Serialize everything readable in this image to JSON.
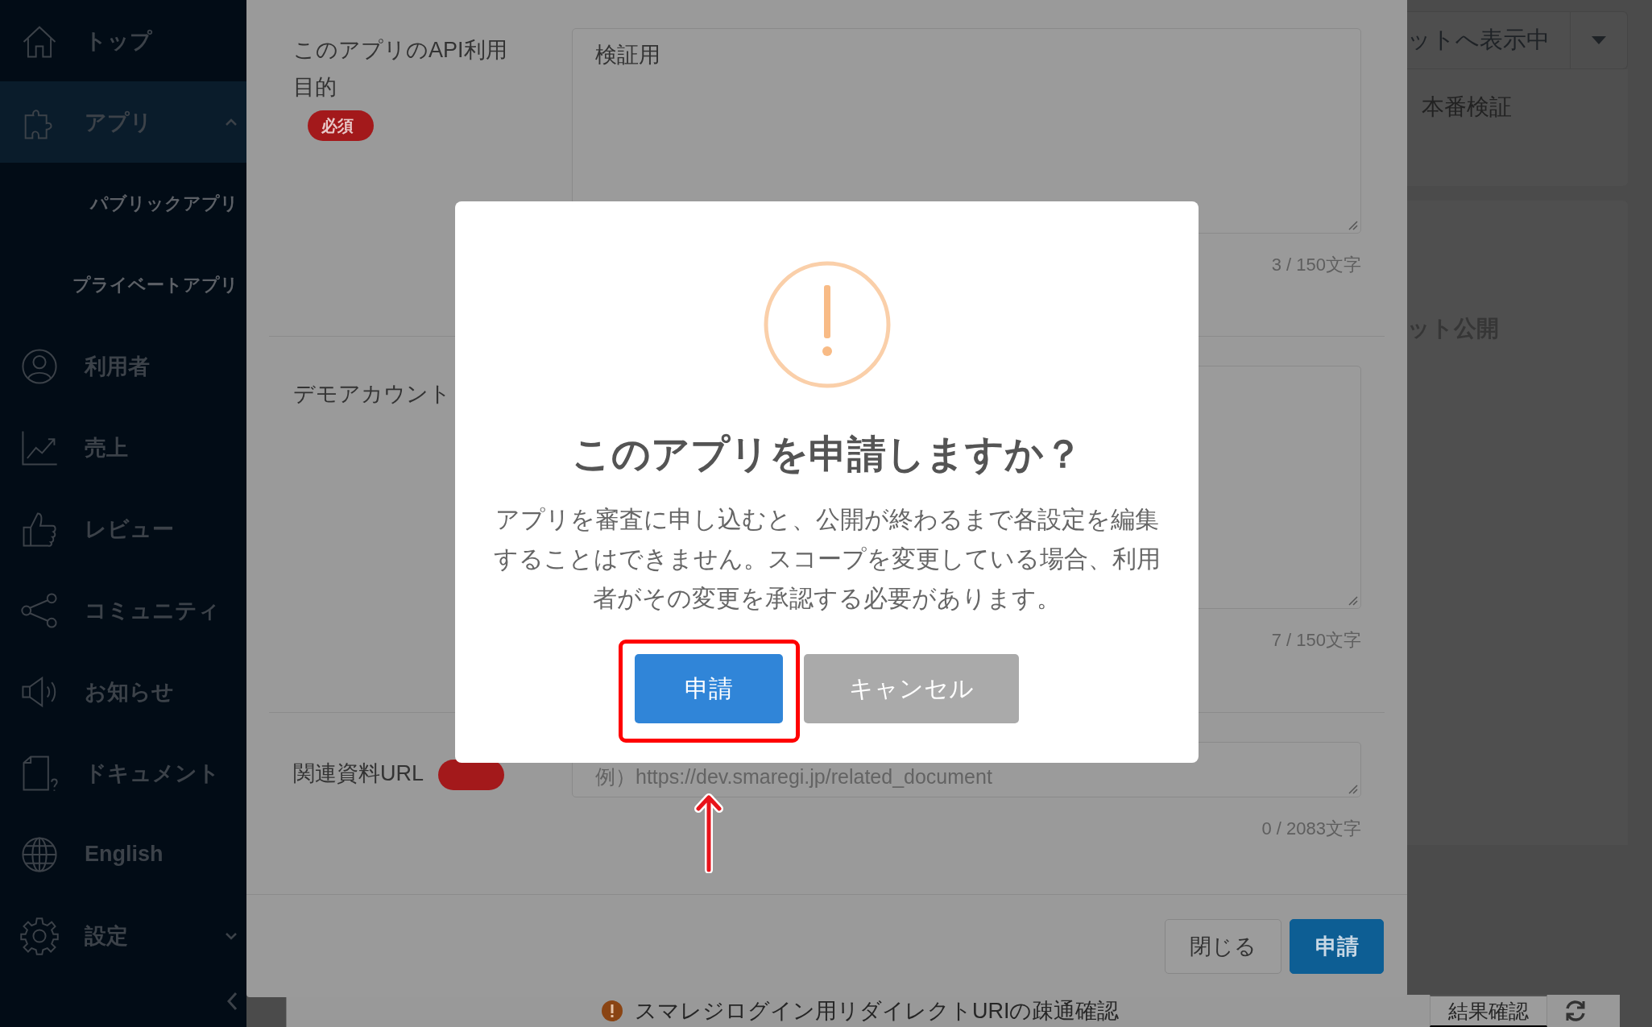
{
  "sidebar": {
    "items": [
      {
        "label": "トップ",
        "selected": false
      },
      {
        "label": "アプリ",
        "selected": true,
        "expanded": true,
        "children": [
          {
            "label": "パブリックアプリ",
            "selected": false
          },
          {
            "label": "プライベートアプリ",
            "selected": false
          }
        ]
      },
      {
        "label": "利用者",
        "selected": false
      },
      {
        "label": "売上",
        "selected": false
      },
      {
        "label": "レビュー",
        "selected": false
      },
      {
        "label": "コミュニティ",
        "selected": false
      },
      {
        "label": "お知らせ",
        "selected": false
      },
      {
        "label": "ドキュメント",
        "selected": false
      },
      {
        "label": "English",
        "selected": false
      },
      {
        "label": "設定",
        "selected": false,
        "expanded": false
      }
    ]
  },
  "background_page": {
    "dropdown": {
      "value": "ットへ表示中"
    },
    "environment_tab": "本番検証",
    "section_title": "ット公開",
    "check_row": {
      "label": "スマレジログイン用リダイレクトURIの疎通確認",
      "button": "結果確認"
    }
  },
  "modal": {
    "fields": [
      {
        "label": "このアプリのAPI利用目的",
        "required": true,
        "badge": "必須",
        "value": "検証用",
        "counter": "3 / 150文字"
      },
      {
        "label": "デモアカウント",
        "required": false,
        "counter": "7 / 150文字"
      },
      {
        "label": "関連資料URL",
        "required": true,
        "placeholder": "例）https://dev.smaregi.jp/related_document",
        "counter": "0 / 2083文字"
      }
    ],
    "buttons": [
      {
        "label": "閉じる",
        "kind": "secondary"
      },
      {
        "label": "申請",
        "kind": "primary"
      }
    ]
  },
  "confirm_dialog": {
    "title": "このアプリを申請しますか？",
    "message": "アプリを審査に申し込むと、公開が終わるまで各設定を編集することはできません。スコープを変更している場合、利用者がその変更を承認する必要があります。",
    "buttons": [
      {
        "label": "申請",
        "kind": "primary"
      },
      {
        "label": "キャンセル",
        "kind": "cancel"
      }
    ]
  }
}
